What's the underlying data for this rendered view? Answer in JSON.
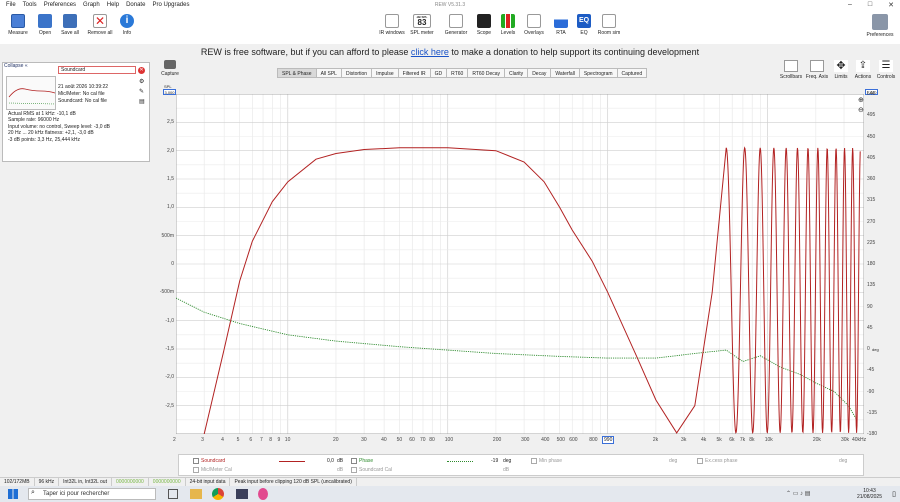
{
  "window": {
    "title": "REW V5.31.3",
    "menu": [
      "File",
      "Tools",
      "Preferences",
      "Graph",
      "Help",
      "Donate",
      "Pro Upgrades"
    ]
  },
  "toolbar": {
    "left": [
      "Measure",
      "Open",
      "Save all",
      "Remove all",
      "Info"
    ],
    "center": [
      "IR windows",
      "SPL meter",
      "Generator",
      "Scope",
      "Levels",
      "Overlays",
      "RTA",
      "EQ",
      "Room sim"
    ],
    "spl_value": "83",
    "spl_unit": "dB SPL",
    "preferences": "Preferences"
  },
  "donate": {
    "before": "REW is free software, but if you can afford to please",
    "link": "click here",
    "after": "to make a donation to help support its continuing development"
  },
  "measurement_panel": {
    "collapse_label": "Collapse",
    "name": "Soundcard",
    "date": "21 août 2026 10:39:22",
    "mic_cal": "Mic/Meter: No cal file",
    "sc_cal": "Soundcard: No cal file",
    "details": [
      "Actual RMS at 1 kHz: -10,1 dB",
      "Sample rate: 96000 Hz",
      "Input volume: no control, Sweep level: -3,0 dB",
      "20 Hz ... 20 kHz flatness: +2,1, -3,0 dB",
      " -3 dB points: 3,3 Hz,  25,444 kHz"
    ]
  },
  "capture_label": "Capture",
  "tabs": [
    "SPL & Phase",
    "All SPL",
    "Distortion",
    "Impulse",
    "Filtered IR",
    "GD",
    "RT60",
    "RT60 Decay",
    "Clarity",
    "Decay",
    "Waterfall",
    "Spectrogram",
    "Captured"
  ],
  "right_tools": [
    "Scrollbars",
    "Freq. Axis",
    "Limits",
    "Actions",
    "Controls"
  ],
  "chart_data": {
    "type": "line",
    "x_axis": {
      "scale": "log",
      "range": [
        2,
        40000
      ],
      "tick_labels": [
        "2",
        "3",
        "4",
        "5",
        "6",
        "7",
        "8",
        "9",
        "10",
        "20",
        "30",
        "40",
        "50",
        "60",
        "70",
        "80",
        "100",
        "200",
        "300",
        "400",
        "500",
        "600",
        "800",
        "1k",
        "2k",
        "3k",
        "4k",
        "5k",
        "6k",
        "7k",
        "8k",
        "10k",
        "20k",
        "30k",
        "40kHz"
      ],
      "marker_label": "990"
    },
    "y_axis_left": {
      "range": [
        -3.0,
        3.0
      ],
      "tick_labels": [
        "3,0",
        "2,5",
        "2,0",
        "1,5",
        "1,0",
        "500m",
        "0",
        "-500m",
        "-1,0",
        "-1,5",
        "-2,0",
        "-2,5"
      ],
      "top_box": "3,000",
      "unit_label": "SPL"
    },
    "y_axis_right": {
      "range": [
        -180,
        540
      ],
      "tick_labels": [
        "540",
        "495",
        "450",
        "405",
        "360",
        "315",
        "270",
        "225",
        "180",
        "135",
        "90",
        "45",
        "0",
        "-45",
        "-90",
        "-135",
        "-180"
      ],
      "top_box": "1.080",
      "unit_label": "deg"
    },
    "series": [
      {
        "name": "Soundcard",
        "color": "#b22222",
        "style": "solid",
        "points": [
          [
            2.2,
            -5.0
          ],
          [
            3.0,
            -3.0
          ],
          [
            4.0,
            -1.5
          ],
          [
            5.0,
            -0.3
          ],
          [
            6.0,
            0.4
          ],
          [
            8.0,
            1.1
          ],
          [
            10.0,
            1.45
          ],
          [
            15.0,
            1.85
          ],
          [
            20.0,
            1.95
          ],
          [
            30.0,
            2.02
          ],
          [
            50.0,
            2.05
          ],
          [
            100.0,
            2.05
          ],
          [
            200.0,
            2.0
          ],
          [
            300.0,
            1.8
          ],
          [
            400.0,
            1.45
          ],
          [
            500.0,
            1.0
          ],
          [
            600.0,
            0.6
          ],
          [
            800.0,
            0.05
          ],
          [
            1000.0,
            -0.5
          ],
          [
            1500.0,
            -1.6
          ],
          [
            2000.0,
            -2.4
          ],
          [
            2700.0,
            -2.98
          ],
          [
            3500.0,
            -2.5
          ],
          [
            4500.0,
            -0.5
          ],
          [
            5500.0,
            2.05
          ]
        ]
      },
      {
        "name": "Phase",
        "color": "#2e8b2e",
        "style": "dotted",
        "points": [
          [
            2.0,
            -0.6
          ],
          [
            3.0,
            -0.85
          ],
          [
            5.0,
            -1.05
          ],
          [
            10.0,
            -1.25
          ],
          [
            20.0,
            -1.36
          ],
          [
            50.0,
            -1.46
          ],
          [
            100.0,
            -1.52
          ],
          [
            200.0,
            -1.58
          ],
          [
            500.0,
            -1.63
          ],
          [
            1000.0,
            -1.66
          ],
          [
            2000.0,
            -1.66
          ],
          [
            4000.0,
            -1.56
          ],
          [
            5500.0,
            -1.52
          ],
          [
            7000.0,
            -1.72
          ],
          [
            9000.0,
            -1.62
          ],
          [
            12000.0,
            -1.82
          ],
          [
            16000.0,
            -1.95
          ],
          [
            20000.0,
            -2.1
          ],
          [
            26000.0,
            -2.25
          ],
          [
            32000.0,
            -2.5
          ],
          [
            36000.0,
            -2.75
          ]
        ]
      }
    ],
    "oscillation": {
      "start_hz": 5500,
      "end_hz": 38000,
      "amplitude": 2.05,
      "trough": -2.98
    }
  },
  "legend": {
    "row1": [
      {
        "name": "Soundcard",
        "value": "0,0",
        "unit": "dB"
      },
      {
        "name": "Phase",
        "value": "-19",
        "unit": "deg"
      },
      {
        "name": "Min phase",
        "value": "",
        "unit": "deg"
      },
      {
        "name": "Ex.cess phase",
        "value": "",
        "unit": "deg"
      }
    ],
    "row2": [
      {
        "name": "Mic/Meter Cal",
        "unit": "dB"
      },
      {
        "name": "Soundcard Cal",
        "unit": "dB"
      }
    ]
  },
  "statusbar": [
    "102/172MB",
    "96 kHz",
    "Int32L in, Int32L out",
    "0000000000",
    "0000000000",
    "24-bit input data",
    "Peak input before clipping 120 dB SPL (uncalibrated)"
  ],
  "taskbar": {
    "search_placeholder": "Taper ici pour rechercher",
    "time": "10:43",
    "date": "21/08/2025"
  }
}
